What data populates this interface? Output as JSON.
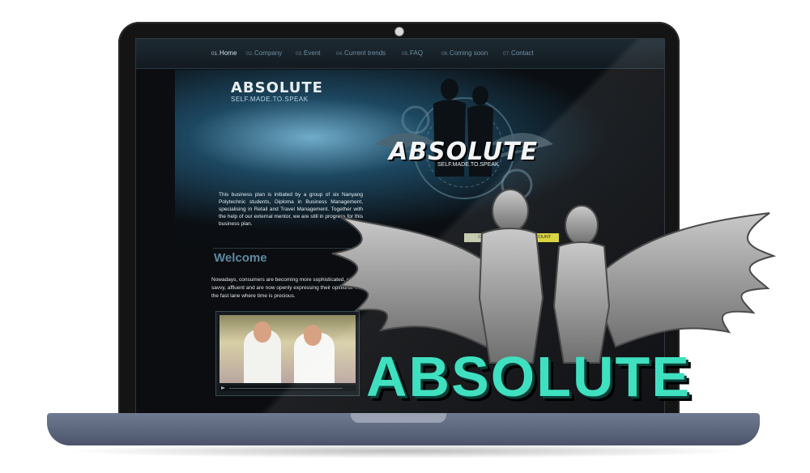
{
  "site": {
    "nav": [
      {
        "num": "01.",
        "label": "Home",
        "active": true
      },
      {
        "num": "02.",
        "label": "Company",
        "active": false
      },
      {
        "num": "03.",
        "label": "Event",
        "active": false
      },
      {
        "num": "04.",
        "label": "Current trends",
        "active": false
      },
      {
        "num": "05.",
        "label": "FAQ",
        "active": false
      },
      {
        "num": "06.",
        "label": "Coming soon",
        "active": false
      },
      {
        "num": "07.",
        "label": "Contact",
        "active": false
      }
    ],
    "hero": {
      "logo": "ABSOLUTE",
      "tagline": "SELF.MADE.TO.SPEAK",
      "emblem_logo": "ABSOLUTE",
      "emblem_tagline": "SELF.MADE.TO.SPEAK",
      "intro": "This business plan is initiated by a group of six Nanyang Polytechnic students, Diploma in Business Management, specialising in Retail and Travel Management. Together with the help of our external mentor, we are still in progress for this business plan.",
      "client_button": "CLIENT",
      "account_button": "MY ACCOUNT"
    },
    "welcome": {
      "title": "Welcome",
      "text": "Nowadays, consumers are becoming more sophisticated, educated, IT savvy, affluent and are now openly expressing their opinions. They live in the fast lane where time is precious."
    }
  },
  "overlay": {
    "logo": "ABSOLUTE"
  },
  "colors": {
    "accent": "#3fe0c0",
    "nav_text": "#6f8fa3",
    "welcome": "#5c8aa3",
    "account_button": "#d8d234"
  }
}
